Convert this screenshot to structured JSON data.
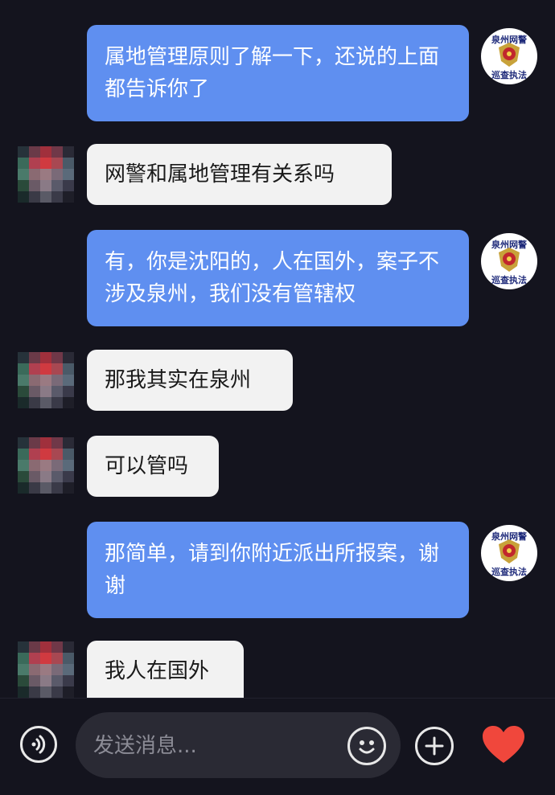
{
  "messages": [
    {
      "direction": "out",
      "text": "属地管理原则了解一下，还说的上面都告诉你了"
    },
    {
      "direction": "in",
      "text": "网警和属地管理有关系吗"
    },
    {
      "direction": "out",
      "text": "有，你是沈阳的，人在国外，案子不涉及泉州，我们没有管辖权"
    },
    {
      "direction": "in",
      "text": "那我其实在泉州"
    },
    {
      "direction": "in",
      "text": "可以管吗"
    },
    {
      "direction": "out",
      "text": "那简单，请到你附近派出所报案，谢谢"
    },
    {
      "direction": "in",
      "text": "我人在国外"
    }
  ],
  "police_avatar": {
    "line1": "泉州网警",
    "line2": "巡查执法",
    "icon": "police-emblem-icon"
  },
  "input": {
    "placeholder": "发送消息..."
  },
  "toolbar": {
    "voice_icon": "voice-icon",
    "emoji_icon": "emoji-icon",
    "plus_icon": "plus-icon",
    "like_icon": "heart-icon"
  },
  "colors": {
    "background": "#14141e",
    "outgoing_bubble": "#5f8ff0",
    "incoming_bubble": "#f2f2f2",
    "heart": "#f0473c"
  }
}
